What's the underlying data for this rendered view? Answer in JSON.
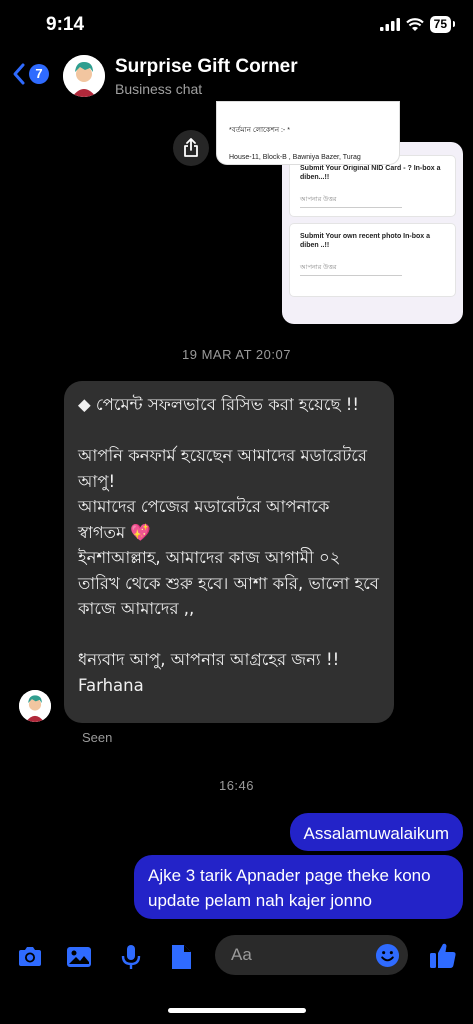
{
  "status": {
    "time": "9:14",
    "battery": "75"
  },
  "header": {
    "unread_count": "7",
    "title": "Surprise Gift Corner",
    "subtitle": "Business chat",
    "icons": [
      "back-chevron-icon",
      "share-icon"
    ]
  },
  "shared_image": {
    "location_label": "*বর্তমান লোকেশন :- *",
    "address": "House-11, Block-B , Bawniya Bazer, Turag",
    "question1": "Submit Your Original NID Card - ? In-box a diben...!!",
    "question2": "Submit Your own recent  photo In-box a diben ..!!",
    "answer_placeholder": "আপনার উত্তর"
  },
  "messages": {
    "date_sep1": "19 MAR AT 20:07",
    "incoming_text": "◆ পেমেন্ট সফলভাবে রিসিভ করা হয়েছে !!\n\nআপনি কনফার্ম হয়েছেন আমাদের মডারেটরে আপু!\nআমাদের পেজের মডারেটরে আপনাকে স্বাগতম 💖\nইনশাআল্লাহ, আমাদের কাজ আগামী ০২ তারিখ থেকে শুরু হবে। আশা করি, ভালো হবে কাজে আমাদের ,,\n\nধন্যবাদ আপু, আপনার আগ্রহের জন্য !!\nFarhana",
    "seen": "Seen",
    "date_sep2": "16:46",
    "outgoing1": "Assalamuwalaikum",
    "outgoing2": "Ajke 3 tarik Apnader page theke kono update pelam nah kajer jonno"
  },
  "composer": {
    "placeholder": "Aa",
    "icons": [
      "camera-icon",
      "gallery-icon",
      "microphone-icon",
      "document-icon",
      "emoji-icon",
      "thumbs-up-icon"
    ]
  },
  "colors": {
    "accent": "#2f6bff",
    "outgoing_bubble": "#2323c8",
    "incoming_bubble": "#303030"
  }
}
